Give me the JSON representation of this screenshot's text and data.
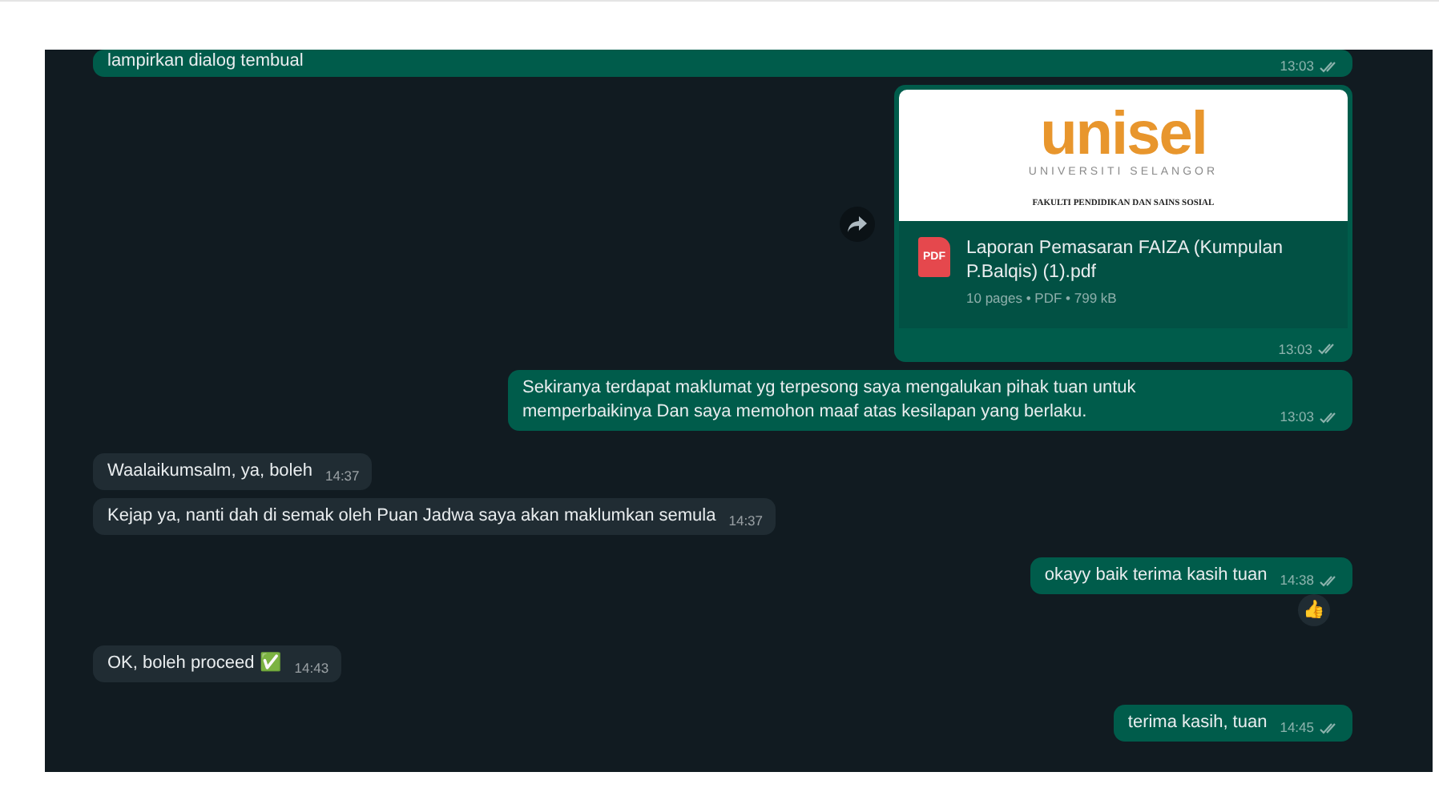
{
  "messages": [
    {
      "kind": "text",
      "outgoing": true,
      "text": "lampirkan dialog tembual",
      "time": "13:03"
    },
    {
      "kind": "document",
      "outgoing": true,
      "preview": {
        "logo": "unisel",
        "subtitle": "UNIVERSITI SELANGOR",
        "heading": "FAKULTI PENDIDIKAN DAN SAINS SOSIAL"
      },
      "file_badge": "PDF",
      "file_name": "Laporan Pemasaran FAIZA (Kumpulan P.Balqis) (1).pdf",
      "file_info": "10 pages • PDF • 799 kB",
      "time": "13:03"
    },
    {
      "kind": "text",
      "outgoing": true,
      "text": "Sekiranya terdapat maklumat yg terpesong saya mengalukan pihak tuan untuk memperbaikinya Dan saya memohon maaf atas kesilapan yang berlaku.",
      "time": "13:03"
    },
    {
      "kind": "text",
      "outgoing": false,
      "text": "Waalaikumsalm, ya, boleh",
      "time": "14:37"
    },
    {
      "kind": "text",
      "outgoing": false,
      "text": "Kejap ya, nanti dah di semak oleh Puan Jadwa saya akan maklumkan semula",
      "time": "14:37"
    },
    {
      "kind": "text",
      "outgoing": true,
      "text": "okayy baik terima kasih tuan",
      "time": "14:38",
      "reaction": "👍"
    },
    {
      "kind": "text",
      "outgoing": false,
      "text": "OK, boleh proceed ✅",
      "time": "14:43"
    },
    {
      "kind": "text",
      "outgoing": true,
      "text": "terima kasih, tuan",
      "time": "14:45"
    }
  ]
}
